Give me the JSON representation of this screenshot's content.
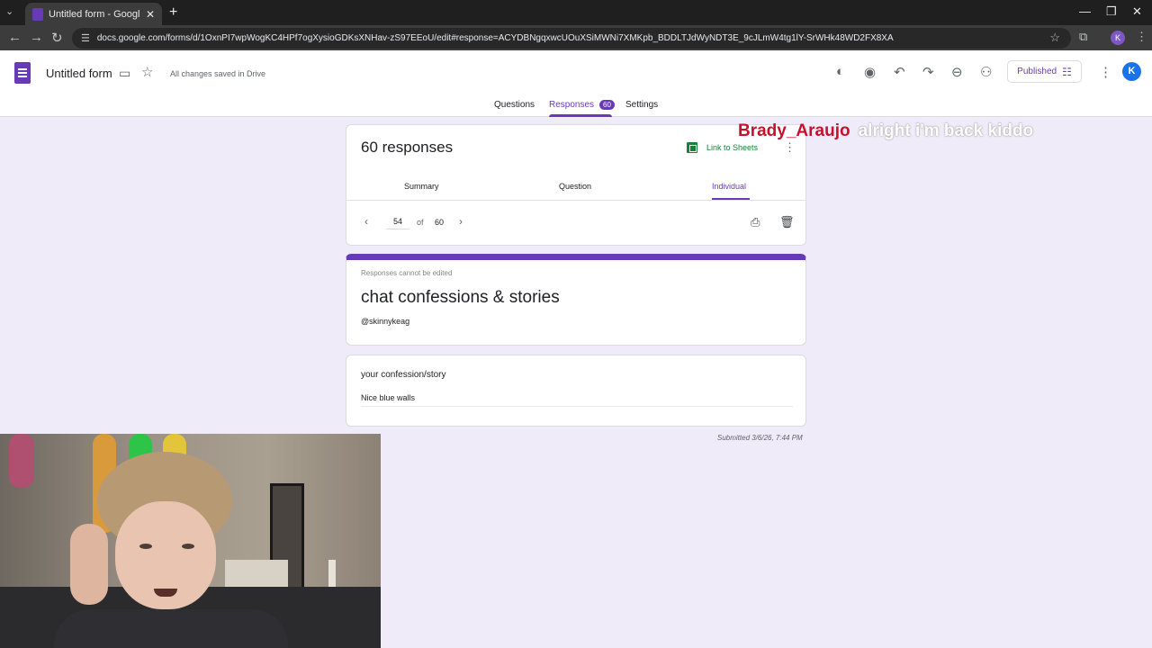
{
  "browser": {
    "tab_title": "Untitled form - Google Forms",
    "url": "docs.google.com/forms/d/1OxnPI7wpWogKC4HPf7ogXysioGDKsXNHav-zS97EEoU/edit#response=ACYDBNgqxwcUOuXSiMWNi7XMKpb_BDDLTJdWyNDT3E_9cJLmW4tg1lY-SrWHk48WD2FX8XA",
    "profile_initial": "K"
  },
  "header": {
    "title": "Untitled form",
    "save_status": "All changes saved in Drive",
    "published_label": "Published",
    "avatar_initial": "K",
    "tabs": {
      "questions": "Questions",
      "responses": "Responses",
      "responses_count": "60",
      "settings": "Settings"
    }
  },
  "responses_card": {
    "heading": "60 responses",
    "link_to_sheets": "Link to Sheets",
    "subtabs": {
      "summary": "Summary",
      "question": "Question",
      "individual": "Individual"
    },
    "pager": {
      "current": "54",
      "of_label": "of",
      "total": "60"
    }
  },
  "form": {
    "note": "Responses cannot be edited",
    "title": "chat confessions & stories",
    "description": "@skinnykeag"
  },
  "question": {
    "label": "your confession/story",
    "answer": "Nice blue walls",
    "submitted": "Submitted 3/6/26, 7:44 PM"
  },
  "chat": {
    "user": "Brady_Araujo",
    "message": "alright i'm back kiddo"
  },
  "colors": {
    "accent": "#673ab7",
    "background": "#f0ebf8",
    "sheets_green": "#188038",
    "chat_user": "#c8102e"
  }
}
